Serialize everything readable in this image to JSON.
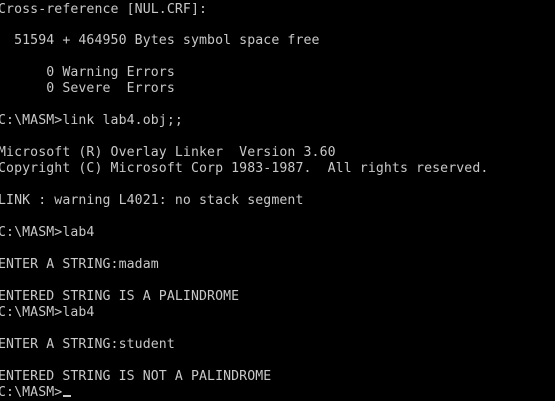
{
  "terminal": {
    "text_color": "#c8c8c8",
    "background_color": "#000000",
    "lines": [
      "Cross-reference [NUL.CRF]:",
      "  51594 + 464950 Bytes symbol space free",
      "      0 Warning Errors",
      "      0 Severe  Errors",
      "C:\\MASM>link lab4.obj;;",
      "Microsoft (R) Overlay Linker  Version 3.60",
      "Copyright (C) Microsoft Corp 1983-1987.  All rights reserved.",
      "LINK : warning L4021: no stack segment",
      "C:\\MASM>lab4",
      "ENTER A STRING:madam",
      "ENTERED STRING IS A PALINDROME",
      "C:\\MASM>lab4",
      "ENTER A STRING:student",
      "ENTERED STRING IS NOT A PALINDROME",
      "C:\\MASM>"
    ]
  }
}
